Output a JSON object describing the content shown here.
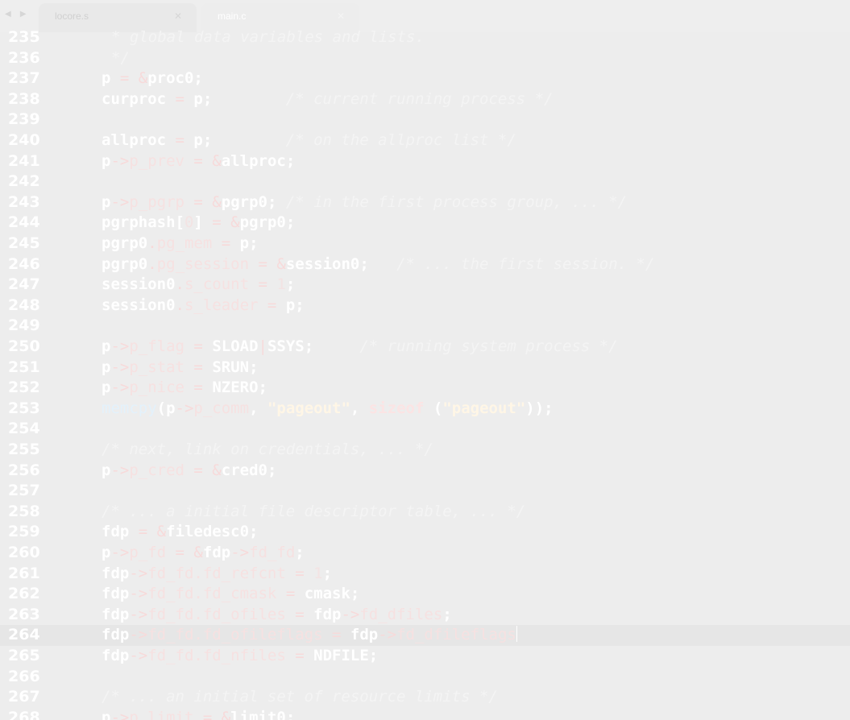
{
  "window": {
    "nav": "◀ ▶",
    "tabs": [
      {
        "label": "locore.s",
        "close": "✕",
        "active": false
      },
      {
        "label": "main.c",
        "close": "✕",
        "active": true
      }
    ]
  },
  "editor": {
    "current_line": 264,
    "lines": [
      {
        "n": "235",
        "tokens": [
          {
            "t": "cm",
            "v": "* global data variables and lists."
          }
        ],
        "indent": 1
      },
      {
        "n": "236",
        "tokens": [
          {
            "t": "cm",
            "v": "*/"
          }
        ],
        "indent": 1
      },
      {
        "n": "237",
        "tokens": [
          {
            "t": "id",
            "v": "p "
          },
          {
            "t": "op",
            "v": "= &"
          },
          {
            "t": "id",
            "v": "proc0;"
          }
        ]
      },
      {
        "n": "238",
        "tokens": [
          {
            "t": "id",
            "v": "curproc "
          },
          {
            "t": "op",
            "v": "= "
          },
          {
            "t": "id",
            "v": "p;        "
          },
          {
            "t": "cm",
            "v": "/* current running process */"
          }
        ]
      },
      {
        "n": "239",
        "tokens": []
      },
      {
        "n": "240",
        "tokens": [
          {
            "t": "id",
            "v": "allproc "
          },
          {
            "t": "op",
            "v": "= "
          },
          {
            "t": "id",
            "v": "p;        "
          },
          {
            "t": "cm",
            "v": "/* on the allproc list */"
          }
        ]
      },
      {
        "n": "241",
        "tokens": [
          {
            "t": "id",
            "v": "p"
          },
          {
            "t": "op",
            "v": "->"
          },
          {
            "t": "mem",
            "v": "p_prev "
          },
          {
            "t": "op",
            "v": "= &"
          },
          {
            "t": "id",
            "v": "allproc;"
          }
        ]
      },
      {
        "n": "242",
        "tokens": []
      },
      {
        "n": "243",
        "tokens": [
          {
            "t": "id",
            "v": "p"
          },
          {
            "t": "op",
            "v": "->"
          },
          {
            "t": "mem",
            "v": "p_pgrp "
          },
          {
            "t": "op",
            "v": "= &"
          },
          {
            "t": "id",
            "v": "pgrp0; "
          },
          {
            "t": "cm",
            "v": "/* in the first process group, ... */"
          }
        ]
      },
      {
        "n": "244",
        "tokens": [
          {
            "t": "id",
            "v": "pgrphash["
          },
          {
            "t": "num",
            "v": "0"
          },
          {
            "t": "id",
            "v": "] "
          },
          {
            "t": "op",
            "v": "= &"
          },
          {
            "t": "id",
            "v": "pgrp0;"
          }
        ]
      },
      {
        "n": "245",
        "tokens": [
          {
            "t": "id",
            "v": "pgrp0"
          },
          {
            "t": "op",
            "v": "."
          },
          {
            "t": "mem",
            "v": "pg_mem "
          },
          {
            "t": "op",
            "v": "= "
          },
          {
            "t": "id",
            "v": "p;"
          }
        ]
      },
      {
        "n": "246",
        "tokens": [
          {
            "t": "id",
            "v": "pgrp0"
          },
          {
            "t": "op",
            "v": "."
          },
          {
            "t": "mem",
            "v": "pg_session "
          },
          {
            "t": "op",
            "v": "= &"
          },
          {
            "t": "id",
            "v": "session0;   "
          },
          {
            "t": "cm",
            "v": "/* ... the first session. */"
          }
        ]
      },
      {
        "n": "247",
        "tokens": [
          {
            "t": "id",
            "v": "session0"
          },
          {
            "t": "op",
            "v": "."
          },
          {
            "t": "mem",
            "v": "s_count "
          },
          {
            "t": "op",
            "v": "= "
          },
          {
            "t": "num",
            "v": "1"
          },
          {
            "t": "id",
            "v": ";"
          }
        ]
      },
      {
        "n": "248",
        "tokens": [
          {
            "t": "id",
            "v": "session0"
          },
          {
            "t": "op",
            "v": "."
          },
          {
            "t": "mem",
            "v": "s_leader "
          },
          {
            "t": "op",
            "v": "= "
          },
          {
            "t": "id",
            "v": "p;"
          }
        ]
      },
      {
        "n": "249",
        "tokens": []
      },
      {
        "n": "250",
        "tokens": [
          {
            "t": "id",
            "v": "p"
          },
          {
            "t": "op",
            "v": "->"
          },
          {
            "t": "mem",
            "v": "p_flag "
          },
          {
            "t": "op",
            "v": "= "
          },
          {
            "t": "id",
            "v": "SLOAD"
          },
          {
            "t": "op",
            "v": "|"
          },
          {
            "t": "id",
            "v": "SSYS;     "
          },
          {
            "t": "cm",
            "v": "/* running system process */"
          }
        ]
      },
      {
        "n": "251",
        "tokens": [
          {
            "t": "id",
            "v": "p"
          },
          {
            "t": "op",
            "v": "->"
          },
          {
            "t": "mem",
            "v": "p_stat "
          },
          {
            "t": "op",
            "v": "= "
          },
          {
            "t": "id",
            "v": "SRUN;"
          }
        ]
      },
      {
        "n": "252",
        "tokens": [
          {
            "t": "id",
            "v": "p"
          },
          {
            "t": "op",
            "v": "->"
          },
          {
            "t": "mem",
            "v": "p_nice "
          },
          {
            "t": "op",
            "v": "= "
          },
          {
            "t": "id",
            "v": "NZERO;"
          }
        ]
      },
      {
        "n": "253",
        "tokens": [
          {
            "t": "fn",
            "v": "memcpy"
          },
          {
            "t": "id",
            "v": "(p"
          },
          {
            "t": "op",
            "v": "->"
          },
          {
            "t": "mem",
            "v": "p_comm"
          },
          {
            "t": "id",
            "v": ", "
          },
          {
            "t": "str",
            "v": "\"pageout\""
          },
          {
            "t": "id",
            "v": ", "
          },
          {
            "t": "kw",
            "v": "sizeof"
          },
          {
            "t": "id",
            "v": " ("
          },
          {
            "t": "str",
            "v": "\"pageout\""
          },
          {
            "t": "id",
            "v": "));"
          }
        ]
      },
      {
        "n": "254",
        "tokens": []
      },
      {
        "n": "255",
        "tokens": [
          {
            "t": "cm",
            "v": "/* next, link on credentials, ... */"
          }
        ]
      },
      {
        "n": "256",
        "tokens": [
          {
            "t": "id",
            "v": "p"
          },
          {
            "t": "op",
            "v": "->"
          },
          {
            "t": "mem",
            "v": "p_cred "
          },
          {
            "t": "op",
            "v": "= &"
          },
          {
            "t": "id",
            "v": "cred0;"
          }
        ]
      },
      {
        "n": "257",
        "tokens": []
      },
      {
        "n": "258",
        "tokens": [
          {
            "t": "cm",
            "v": "/* ... a initial file descriptor table, ... */"
          }
        ]
      },
      {
        "n": "259",
        "tokens": [
          {
            "t": "id",
            "v": "fdp "
          },
          {
            "t": "op",
            "v": "= &"
          },
          {
            "t": "id",
            "v": "filedesc0;"
          }
        ]
      },
      {
        "n": "260",
        "tokens": [
          {
            "t": "id",
            "v": "p"
          },
          {
            "t": "op",
            "v": "->"
          },
          {
            "t": "mem",
            "v": "p_fd "
          },
          {
            "t": "op",
            "v": "= &"
          },
          {
            "t": "id",
            "v": "fdp"
          },
          {
            "t": "op",
            "v": "->"
          },
          {
            "t": "mem",
            "v": "fd_fd"
          },
          {
            "t": "id",
            "v": ";"
          }
        ]
      },
      {
        "n": "261",
        "tokens": [
          {
            "t": "id",
            "v": "fdp"
          },
          {
            "t": "op",
            "v": "->"
          },
          {
            "t": "mem",
            "v": "fd_fd.fd_refcnt "
          },
          {
            "t": "op",
            "v": "= "
          },
          {
            "t": "num",
            "v": "1"
          },
          {
            "t": "id",
            "v": ";"
          }
        ]
      },
      {
        "n": "262",
        "tokens": [
          {
            "t": "id",
            "v": "fdp"
          },
          {
            "t": "op",
            "v": "->"
          },
          {
            "t": "mem",
            "v": "fd_fd.fd_cmask "
          },
          {
            "t": "op",
            "v": "= "
          },
          {
            "t": "id",
            "v": "cmask;"
          }
        ]
      },
      {
        "n": "263",
        "tokens": [
          {
            "t": "id",
            "v": "fdp"
          },
          {
            "t": "op",
            "v": "->"
          },
          {
            "t": "mem",
            "v": "fd_fd.fd_ofiles "
          },
          {
            "t": "op",
            "v": "= "
          },
          {
            "t": "id",
            "v": "fdp"
          },
          {
            "t": "op",
            "v": "->"
          },
          {
            "t": "mem",
            "v": "fd_dfiles"
          },
          {
            "t": "id",
            "v": ";"
          }
        ]
      },
      {
        "n": "264",
        "tokens": [
          {
            "t": "id",
            "v": "fdp"
          },
          {
            "t": "op",
            "v": "->"
          },
          {
            "t": "mem",
            "v": "fd_fd.fd_ofileflags "
          },
          {
            "t": "op",
            "v": "= "
          },
          {
            "t": "id",
            "v": "fdp"
          },
          {
            "t": "op",
            "v": "->"
          },
          {
            "t": "mem",
            "v": "fd_dfileflags"
          }
        ],
        "cursor": true
      },
      {
        "n": "265",
        "tokens": [
          {
            "t": "id",
            "v": "fdp"
          },
          {
            "t": "op",
            "v": "->"
          },
          {
            "t": "mem",
            "v": "fd_fd.fd_nfiles "
          },
          {
            "t": "op",
            "v": "= "
          },
          {
            "t": "id",
            "v": "NDFILE;"
          }
        ]
      },
      {
        "n": "266",
        "tokens": []
      },
      {
        "n": "267",
        "tokens": [
          {
            "t": "cm",
            "v": "/* ... an initial set of resource limits */"
          }
        ]
      },
      {
        "n": "268",
        "tokens": [
          {
            "t": "id",
            "v": "p"
          },
          {
            "t": "op",
            "v": "->"
          },
          {
            "t": "mem",
            "v": "p_limit "
          },
          {
            "t": "op",
            "v": "= &"
          },
          {
            "t": "id",
            "v": "limit0;"
          }
        ]
      }
    ]
  }
}
